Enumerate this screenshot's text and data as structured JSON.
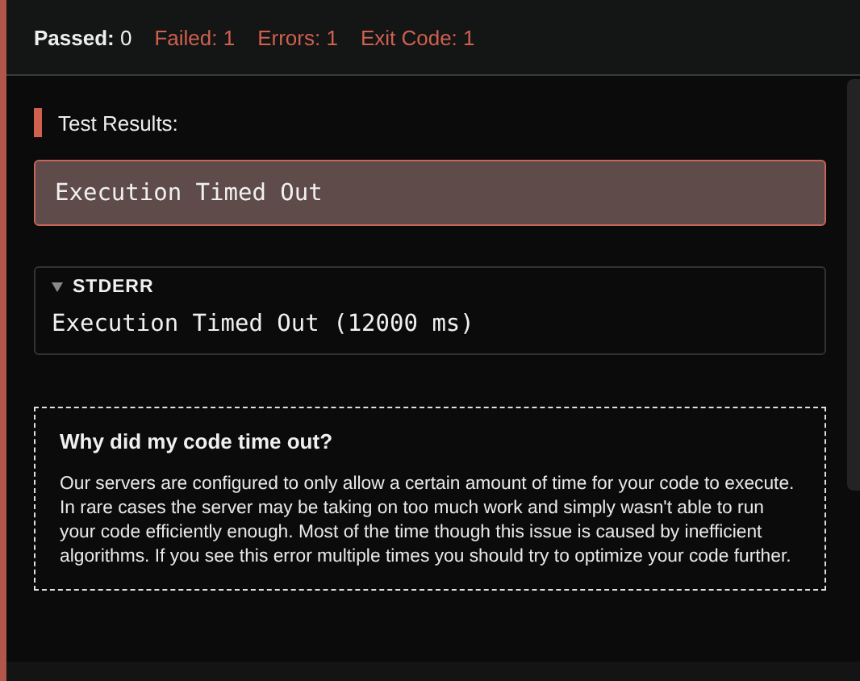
{
  "stats": [
    {
      "label": "Passed:",
      "value": "0",
      "kind": "ok"
    },
    {
      "label": "Failed:",
      "value": "1",
      "kind": "bad"
    },
    {
      "label": "Errors:",
      "value": "1",
      "kind": "bad"
    },
    {
      "label": "Exit Code:",
      "value": "1",
      "kind": "bad"
    }
  ],
  "results": {
    "heading": "Test Results:",
    "message": "Execution Timed Out"
  },
  "stderr": {
    "title": "STDERR",
    "expanded": true,
    "output": "Execution Timed Out (12000 ms)"
  },
  "help": {
    "title": "Why did my code time out?",
    "text": "Our servers are configured to only allow a certain amount of time for your code to execute. In rare cases the server may be taking on too much work and simply wasn't able to run your code efficiently enough. Most of the time though this issue is caused by inefficient algorithms. If you see this error multiple times you should try to optimize your code further."
  }
}
